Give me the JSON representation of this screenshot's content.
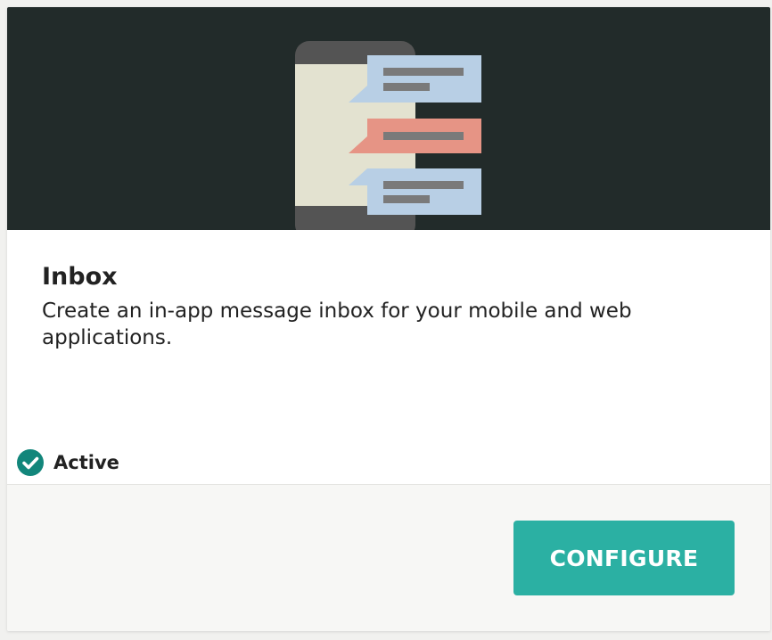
{
  "card": {
    "title": "Inbox",
    "description": "Create an in-app message inbox for your mobile and web applications.",
    "status": {
      "label": "Active",
      "icon": "check-circle-icon",
      "color": "#12867b"
    },
    "configure_label": "CONFIGURE"
  },
  "hero": {
    "icon": "inbox-illustration",
    "colors": {
      "background": "#222b2a",
      "phone_frame": "#545454",
      "phone_screen": "#e3e2d0",
      "bubble_blue": "#b8cfe5",
      "bubble_red": "#e69485",
      "text_lines": "#7a7a7a"
    }
  },
  "theme": {
    "accent": "#2bb0a3"
  }
}
